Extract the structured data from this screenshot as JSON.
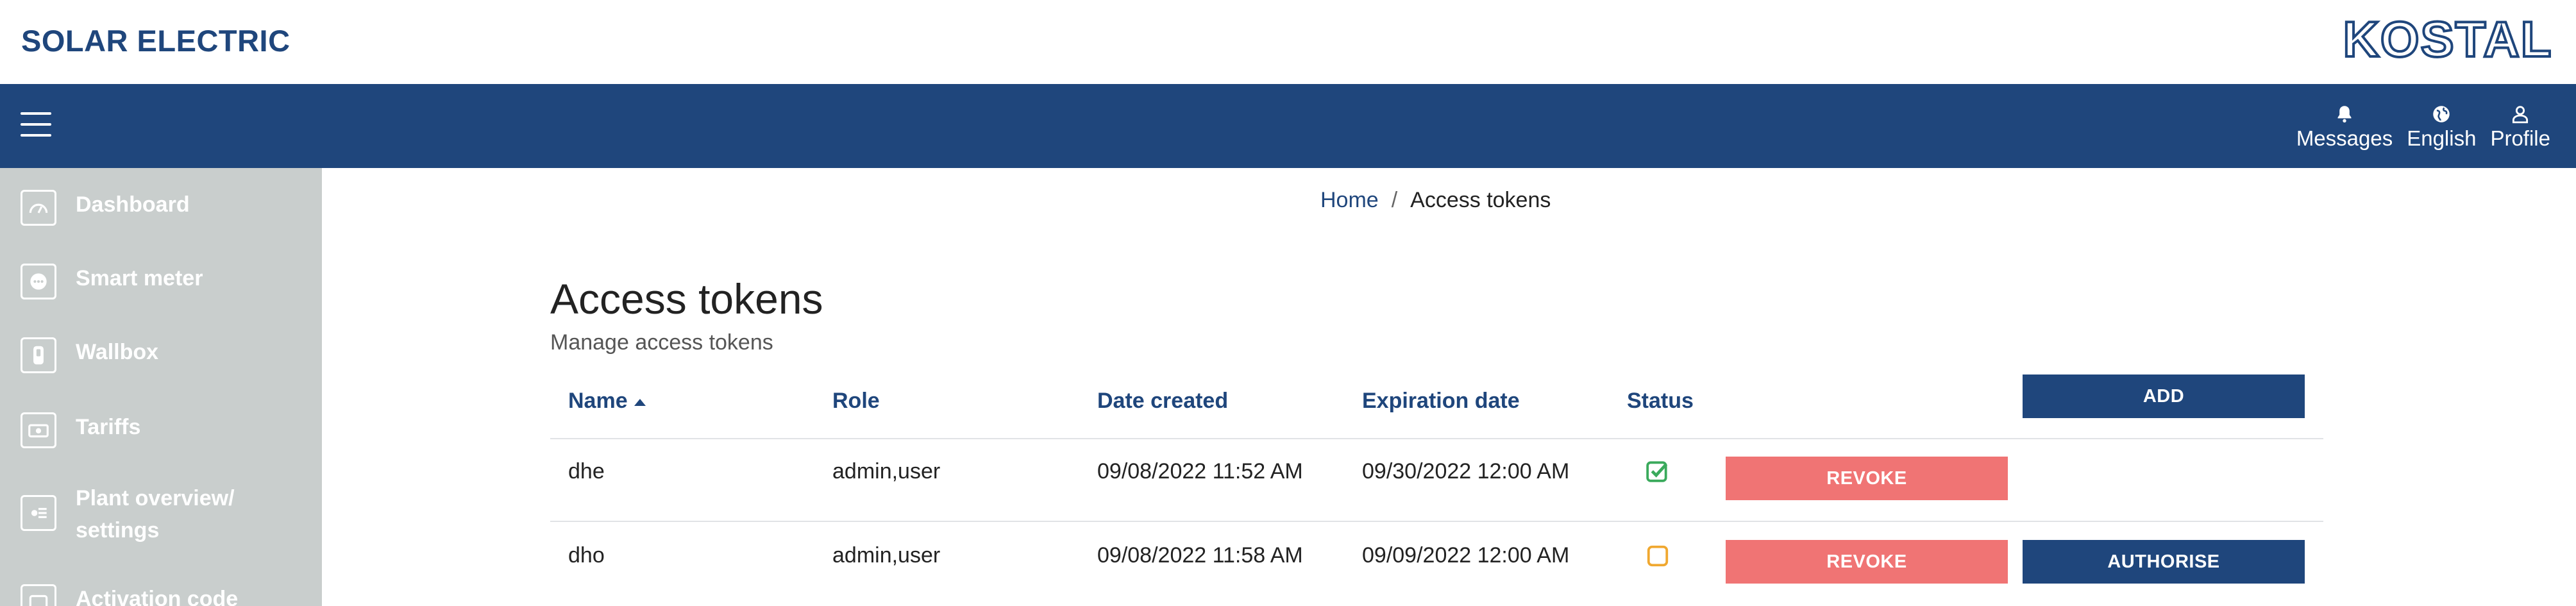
{
  "app": {
    "title": "SOLAR ELECTRIC",
    "logo_text": "KOSTAL"
  },
  "colors": {
    "brand_blue": "#1f467c",
    "revoke_red": "#f07474",
    "sidebar_gray": "#c9cecd",
    "status_ok": "#3aaa5c",
    "status_pending": "#f0a830"
  },
  "nav": {
    "actions": [
      {
        "label": "Messages",
        "icon": "bell-icon"
      },
      {
        "label": "English",
        "icon": "globe-icon"
      },
      {
        "label": "Profile",
        "icon": "user-icon"
      }
    ]
  },
  "sidebar": {
    "items": [
      {
        "label": "Dashboard",
        "icon": "gauge-icon"
      },
      {
        "label": "Smart meter",
        "icon": "meter-icon"
      },
      {
        "label": "Wallbox",
        "icon": "wallbox-icon"
      },
      {
        "label": "Tariffs",
        "icon": "tariff-icon"
      },
      {
        "label": "Plant overview/",
        "label2": "settings",
        "icon": "plant-icon"
      },
      {
        "label": "Activation code",
        "icon": "activation-icon"
      }
    ]
  },
  "breadcrumb": {
    "home": "Home",
    "separator": "/",
    "current": "Access tokens"
  },
  "header": {
    "title": "Access tokens",
    "subtitle": "Manage access tokens"
  },
  "table": {
    "columns": [
      "Name",
      "Role",
      "Date created",
      "Expiration date",
      "Status"
    ],
    "sort_column": "Name",
    "sort_direction": "ascending",
    "add_label": "ADD",
    "rows": [
      {
        "name": "dhe",
        "role": "admin,user",
        "created": "09/08/2022 11:52 AM",
        "expires": "09/30/2022 12:00 AM",
        "status": "authorised",
        "revoke_label": "REVOKE"
      },
      {
        "name": "dho",
        "role": "admin,user",
        "created": "09/08/2022 11:58 AM",
        "expires": "09/09/2022 12:00 AM",
        "status": "pending",
        "revoke_label": "REVOKE",
        "authorise_label": "AUTHORISE"
      }
    ]
  }
}
